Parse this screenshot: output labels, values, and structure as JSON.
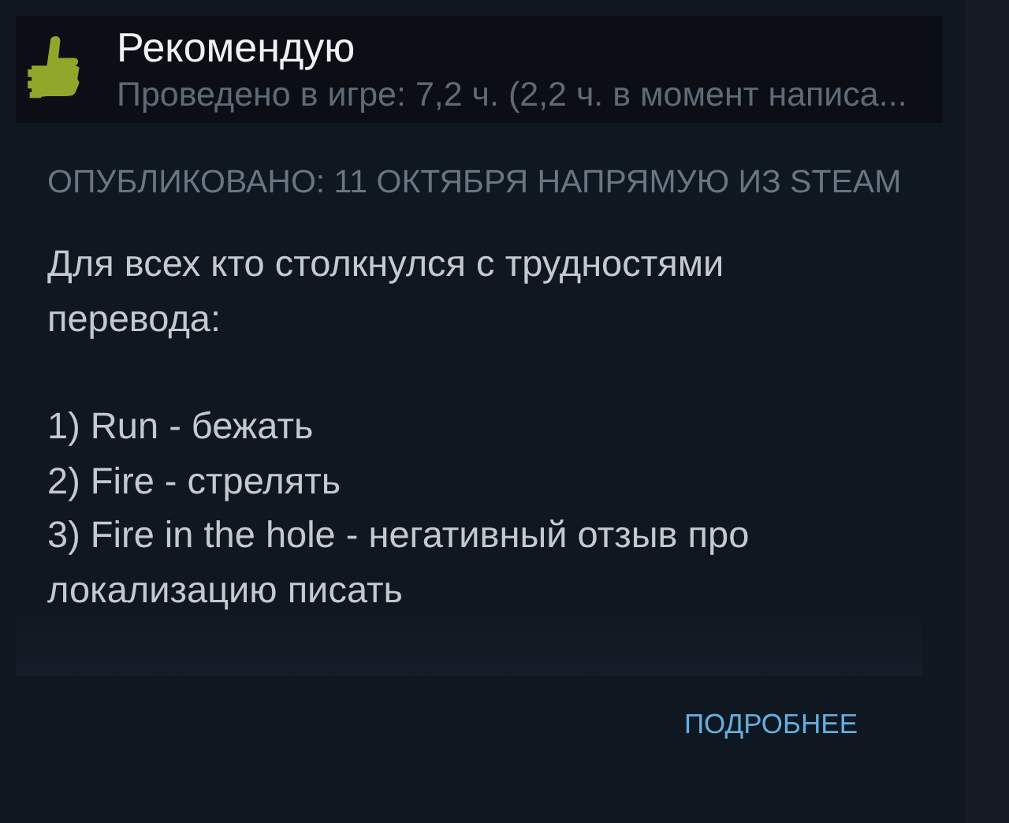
{
  "review": {
    "recommended": true,
    "verdict": "Рекомендую",
    "playtime": "Проведено в игре: 7,2 ч. (2,2 ч. в момент написа...",
    "posted": "ОПУБЛИКОВАНО: 11 ОКТЯБРЯ  НАПРЯМУЮ ИЗ STEAM",
    "intro": "Для всех кто столкнулся с трудностями перевода:",
    "list": [
      "1) Run - бежать",
      "2) Fire - стрелять",
      "3) Fire in the hole - негативный отзыв про локализацию писать"
    ],
    "more_link": "ПОДРОБНЕЕ"
  }
}
